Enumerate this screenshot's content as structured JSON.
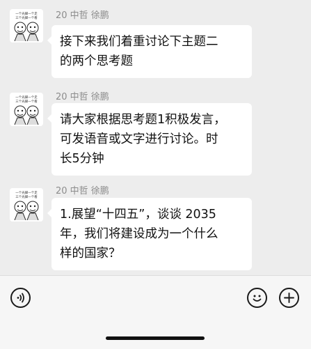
{
  "messages": [
    {
      "sender": "20 中哲 徐鹏",
      "avatar": {
        "icon": "meme-cartoon-avatar-icon",
        "caption_line1": "一个光脚一个走",
        "caption_line2": "三个光脚一个看"
      },
      "lines": [
        "接下来我们着重讨论下主题二",
        "的两个思考题"
      ]
    },
    {
      "sender": "20 中哲 徐鹏",
      "avatar": {
        "icon": "meme-cartoon-avatar-icon",
        "caption_line1": "一个光脚一个走",
        "caption_line2": "三个光脚一个看"
      },
      "lines": [
        "请大家根据思考题1积极发言，",
        "可发语音或文字进行讨论。时",
        "长5分钟"
      ]
    },
    {
      "sender": "20 中哲 徐鹏",
      "avatar": {
        "icon": "meme-cartoon-avatar-icon",
        "caption_line1": "一个光脚一个走",
        "caption_line2": "三个光脚一个看"
      },
      "lines": [
        "1.展望“十四五”，谈谈 2035",
        "年，我们将建设成为一个什么",
        "样的国家？"
      ]
    }
  ],
  "input_bar": {
    "voice_icon": "voice-input-icon",
    "emoji_icon": "emoji-icon",
    "more_icon": "plus-icon"
  }
}
